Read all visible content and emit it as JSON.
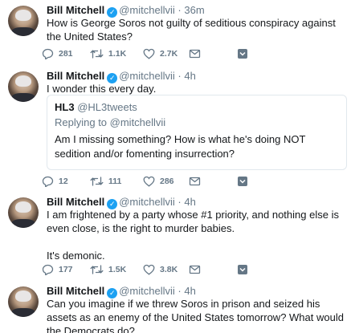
{
  "colors": {
    "verified_blue": "#1da1f2",
    "meta_gray": "#657786",
    "divider": "#e1e8ed"
  },
  "icons": [
    "reply-icon",
    "retweet-icon",
    "like-icon",
    "message-icon",
    "verified-icon",
    "more-chevron-icon"
  ],
  "tweets": [
    {
      "name": "Bill Mitchell",
      "handle": "@mitchellvii",
      "separator": "·",
      "time": "36m",
      "text": "How is George Soros not guilty of seditious conspiracy against the United States?",
      "replies": "281",
      "retweets": "1.1K",
      "likes": "2.7K"
    },
    {
      "name": "Bill Mitchell",
      "handle": "@mitchellvii",
      "separator": "·",
      "time": "4h",
      "text": "I wonder this every day.",
      "quote": {
        "name": "HL3",
        "handle": "@HL3tweets",
        "reply_to": "Replying to @mitchellvii",
        "text": "Am I missing something? How is what he's doing NOT sedition and/or fomenting insurrection?"
      },
      "replies": "12",
      "retweets": "111",
      "likes": "286"
    },
    {
      "name": "Bill Mitchell",
      "handle": "@mitchellvii",
      "separator": "·",
      "time": "4h",
      "text": "I am frightened by a party whose #1 priority, and nothing else is even close, is the right to murder babies.",
      "text2": "It's demonic.",
      "replies": "177",
      "retweets": "1.5K",
      "likes": "3.8K"
    },
    {
      "name": "Bill Mitchell",
      "handle": "@mitchellvii",
      "separator": "·",
      "time": "4h",
      "text": "Can you imagine if we threw Soros in prison and seized his assets as an enemy of the United States tomorrow?  What would the Democrats do?"
    }
  ]
}
